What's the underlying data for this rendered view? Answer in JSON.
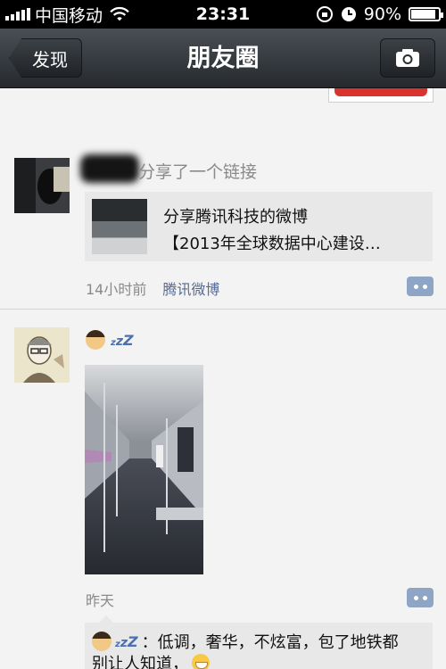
{
  "status_bar": {
    "carrier": "中国移动",
    "time": "23:31",
    "battery_text": "90%",
    "battery_level": 0.9
  },
  "nav": {
    "back_label": "发现",
    "title": "朋友圈"
  },
  "posts": [
    {
      "share_text": "分享了一个链接",
      "link": {
        "title": "分享腾讯科技的微博",
        "desc": "【2013年全球数据中心建设…"
      },
      "time": "14小时前",
      "source": "腾讯微博"
    },
    {
      "time": "昨天",
      "comment": {
        "line1": "：低调，奢华，不炫富，包了地铁都",
        "line2": "别让人知道，"
      }
    }
  ],
  "colors": {
    "link_blue": "#566b95",
    "meta_gray": "#8a8a8a",
    "nav_dark": "#262a2e"
  }
}
